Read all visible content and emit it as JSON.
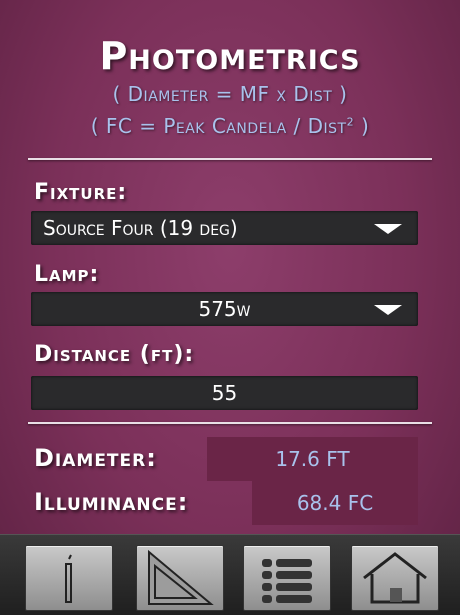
{
  "header": {
    "title": "Photometrics",
    "formula_diameter": "( Diameter = MF x Dist )",
    "formula_fc_prefix": "( FC = Peak Candela / Dist",
    "formula_fc_sup": "2",
    "formula_fc_suffix": " )"
  },
  "fixture": {
    "label": "Fixture:",
    "value": "Source Four (19 deg)"
  },
  "lamp": {
    "label": "Lamp:",
    "value": "575w"
  },
  "distance": {
    "label": "Distance (ft):",
    "value": "55"
  },
  "results": {
    "diameter_label": "Diameter:",
    "diameter_value": "17.6 FT",
    "illuminance_label": "Illuminance:",
    "illuminance_value": "68.4 FC"
  },
  "toolbar": {
    "buttons": [
      "info-icon",
      "triangle-icon",
      "list-icon",
      "home-icon"
    ]
  },
  "colors": {
    "background": "#7b3059",
    "formula_text": "#a9c2ec",
    "field_bg": "#2a2a2c",
    "result_box": "#6a2547"
  }
}
